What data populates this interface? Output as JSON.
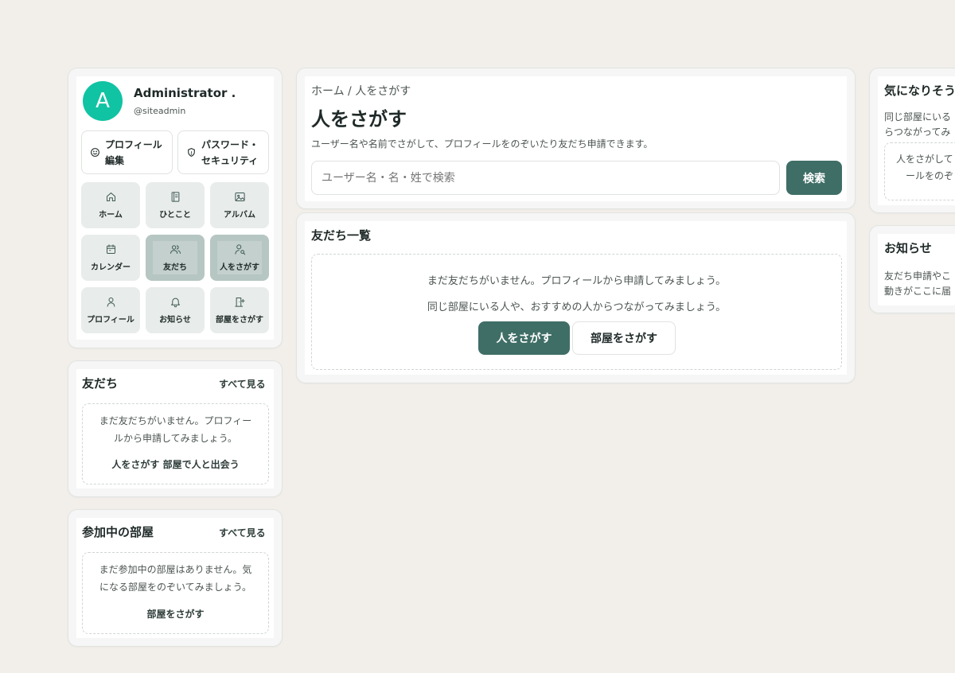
{
  "profile": {
    "avatar_letter": "A",
    "name": "Administrator .",
    "handle": "@siteadmin",
    "edit_button": [
      "プロフィール",
      "編集"
    ],
    "security_button": [
      "パスワード・",
      "セキュリティ"
    ],
    "avatar_color": "#10c3a3"
  },
  "nav": {
    "items": [
      {
        "label": "ホーム",
        "icon": "home-icon"
      },
      {
        "label": "ひとこと",
        "icon": "notebook-icon"
      },
      {
        "label": "アルバム",
        "icon": "image-icon"
      },
      {
        "label": "カレンダー",
        "icon": "calendar-icon"
      },
      {
        "label": "友だち",
        "icon": "users-icon"
      },
      {
        "label": "人をさがす",
        "icon": "user-search-icon"
      },
      {
        "label": "プロフィール",
        "icon": "user-icon"
      },
      {
        "label": "お知らせ",
        "icon": "bell-icon"
      },
      {
        "label": "部屋をさがす",
        "icon": "door-icon"
      }
    ]
  },
  "friends_widget": {
    "title": "友だち",
    "see_all": "すべて見る",
    "empty_lines": [
      "まだ友だちがいません。プロフィー",
      "ルから申請してみましょう。"
    ],
    "link_people": "人をさがす",
    "link_rooms": "部屋で人と出会う"
  },
  "rooms_widget": {
    "title": "参加中の部屋",
    "see_all": "すべて見る",
    "empty_lines": [
      "まだ参加中の部屋はありません。気",
      "になる部屋をのぞいてみましょう。"
    ],
    "link": "部屋をさがす"
  },
  "search": {
    "breadcrumb_home": "ホーム",
    "breadcrumb_sep": "/",
    "breadcrumb_current": "人をさがす",
    "title": "人をさがす",
    "description": "ユーザー名や名前でさがして、プロフィールをのぞいたり友だち申請できます。",
    "placeholder": "ユーザー名・名・姓で検索",
    "button": "検索"
  },
  "friends_list": {
    "title": "友だち一覧",
    "empty_line1": "まだ友だちがいません。プロフィールから申請してみましょう。",
    "empty_line2": "同じ部屋にいる人や、おすすめの人からつながってみましょう。",
    "btn_people": "人をさがす",
    "btn_rooms": "部屋をさがす"
  },
  "right_suggest": {
    "title": "気になりそう",
    "lines": [
      "同じ部屋にいる",
      "らつながってみ"
    ],
    "box_lines": [
      "人をさがして",
      "ールをのぞ"
    ]
  },
  "right_notice": {
    "title": "お知らせ",
    "lines": [
      "友だち申請やこ",
      "動きがここに届"
    ]
  },
  "colors": {
    "accent": "#3f6e66",
    "page_bg": "#f2efeb"
  }
}
